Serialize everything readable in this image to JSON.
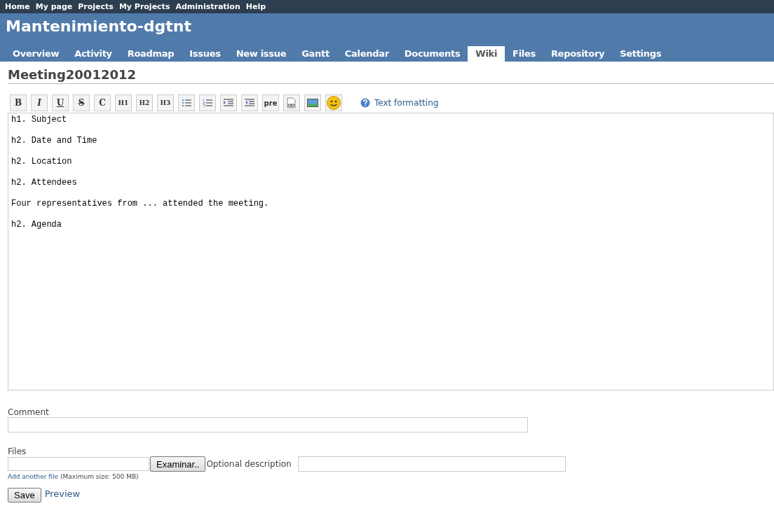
{
  "top_menu": [
    "Home",
    "My page",
    "Projects",
    "My Projects",
    "Administration",
    "Help"
  ],
  "project_title": "Mantenimiento-dgtnt",
  "tabs": [
    {
      "label": "Overview",
      "selected": false
    },
    {
      "label": "Activity",
      "selected": false
    },
    {
      "label": "Roadmap",
      "selected": false
    },
    {
      "label": "Issues",
      "selected": false
    },
    {
      "label": "New issue",
      "selected": false
    },
    {
      "label": "Gantt",
      "selected": false
    },
    {
      "label": "Calendar",
      "selected": false
    },
    {
      "label": "Documents",
      "selected": false
    },
    {
      "label": "Wiki",
      "selected": true
    },
    {
      "label": "Files",
      "selected": false
    },
    {
      "label": "Repository",
      "selected": false
    },
    {
      "label": "Settings",
      "selected": false
    }
  ],
  "page_title": "Meeting20012012",
  "toolbar": [
    {
      "kind": "bold",
      "label": "B"
    },
    {
      "kind": "italic",
      "label": "I"
    },
    {
      "kind": "underline",
      "label": "U"
    },
    {
      "kind": "strike",
      "label": "S"
    },
    {
      "kind": "code",
      "label": "C"
    },
    {
      "kind": "heading",
      "label": "H1"
    },
    {
      "kind": "heading",
      "label": "H2"
    },
    {
      "kind": "heading",
      "label": "H3"
    },
    {
      "kind": "bullet-list"
    },
    {
      "kind": "numbered-list"
    },
    {
      "kind": "indent"
    },
    {
      "kind": "outdent"
    },
    {
      "kind": "pre",
      "label": "pre"
    },
    {
      "kind": "link"
    },
    {
      "kind": "image"
    },
    {
      "kind": "smiley"
    }
  ],
  "help_link": "Text formatting",
  "content": "h1. Subject\n\nh2. Date and Time\n\nh2. Location\n\nh2. Attendees\n\nFour representatives from ... attended the meeting.\n\nh2. Agenda",
  "comment_label": "Comment",
  "files_label": "Files",
  "browse_button": "Examinar..",
  "optional_description": "Optional description",
  "add_file_link": "Add another file",
  "max_size": "(Maximum size: 500 MB)",
  "save_button": "Save",
  "preview_link": "Preview"
}
